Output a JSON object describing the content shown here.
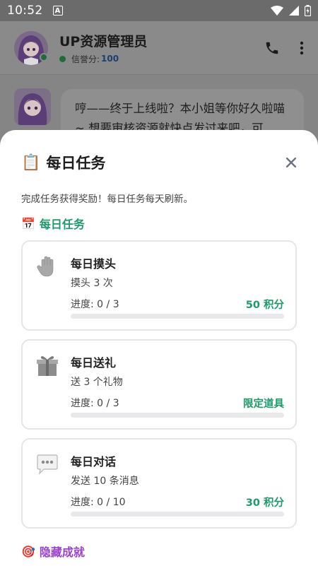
{
  "status_bar": {
    "time": "10:52",
    "a_icon": "A"
  },
  "chat": {
    "title": "UP资源管理员",
    "reputation_label": "信誉分:",
    "reputation_value": "100",
    "message": "哼——终于上线啦？本小姐等你好久啦喵~ 想要审核资源就快点发过来吧，可"
  },
  "sheet": {
    "title_emoji": "📋",
    "title": "每日任务",
    "description": "完成任务获得奖励！每日任务每天刷新。",
    "daily_section": {
      "emoji": "📅",
      "title": "每日任务"
    },
    "tasks": [
      {
        "icon": "hand-icon",
        "name": "每日摸头",
        "desc": "摸头 3 次",
        "progress": "进度: 0 / 3",
        "reward": "50 积分",
        "fraction": 0
      },
      {
        "icon": "gift-icon",
        "name": "每日送礼",
        "desc": "送 3 个礼物",
        "progress": "进度: 0 / 3",
        "reward": "限定道具",
        "fraction": 0
      },
      {
        "icon": "speech-bubble-icon",
        "name": "每日对话",
        "desc": "发送 10 条消息",
        "progress": "进度: 0 / 10",
        "reward": "30 积分",
        "fraction": 0
      }
    ],
    "hidden_section": {
      "emoji": "🎯",
      "title": "隐藏成就"
    }
  },
  "colors": {
    "accent_green": "#1c9a6b",
    "accent_purple": "#9b3fd5",
    "overlay": "#858585"
  }
}
